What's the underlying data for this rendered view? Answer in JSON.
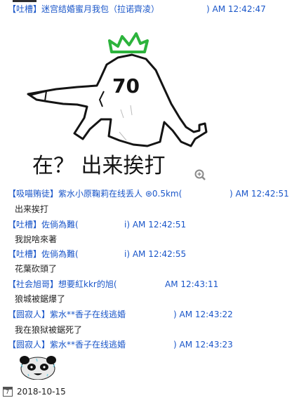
{
  "messages": [
    {
      "tag": "【吐槽】",
      "name": "迷宫结婚蜜月我包（拉诺齊凌）",
      "time": ") AM 12:42:47",
      "text": ""
    },
    {
      "tag": "【吸喵贿徒】",
      "name": "紫水小原鞠莉在线丢人  ⊛0.5km(",
      "time": ") AM 12:42:51",
      "text": "出来挨打"
    },
    {
      "tag": "【吐槽】",
      "name": "佐倘為難(",
      "time": "i) AM 12:42:51",
      "text": "我說啥來著"
    },
    {
      "tag": "【吐槽】",
      "name": "佐倘為難(",
      "time": "i) AM 12:42:55",
      "text": "花葉砍頭了"
    },
    {
      "tag": "【社会旭哥】",
      "name": "想要紅kkr的旭(",
      "time": "AM 12:43:11",
      "text": "狼城被鋸爆了"
    },
    {
      "tag": "【圆寂人】",
      "name": "紫水**香子在线逃婚",
      "time": ") AM 12:43:22",
      "text": "我在狼狱被鋸死了"
    },
    {
      "tag": "【圆寂人】",
      "name": "紫水**香子在线逃婚",
      "time": ") AM 12:43:23",
      "text": ""
    }
  ],
  "sticker": {
    "face_text": "70",
    "caption": "在？ 出来挨打"
  },
  "footer": {
    "calendar_day": "7",
    "date": "2018-10-15"
  }
}
